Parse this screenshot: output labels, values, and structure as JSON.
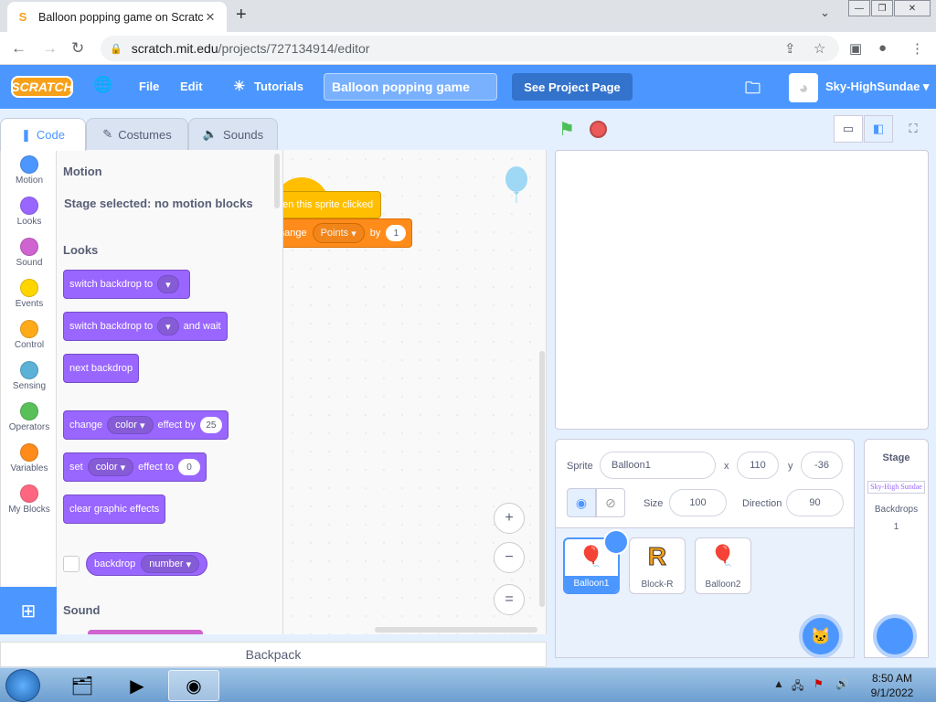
{
  "browser": {
    "tab_title": "Balloon popping game on Scratch",
    "tab_favicon": "S",
    "close_tab": "✕",
    "new_tab": "+",
    "tab_dropdown": "⌄",
    "url_domain": "scratch.mit.edu",
    "url_path": "/projects/727134914/editor",
    "back": "←",
    "forward": "→",
    "reload": "↻",
    "lock": "🔒"
  },
  "menubar": {
    "logo": "SCRATCH",
    "globe": "🌐",
    "file": "File",
    "edit": "Edit",
    "tutorials": "Tutorials",
    "project_title": "Balloon popping game",
    "see_project": "See Project Page",
    "username": "Sky-HighSundae"
  },
  "tabs": {
    "code": "Code",
    "costumes": "Costumes",
    "sounds": "Sounds"
  },
  "categories": [
    {
      "label": "Motion",
      "color": "#4c97ff"
    },
    {
      "label": "Looks",
      "color": "#9966ff"
    },
    {
      "label": "Sound",
      "color": "#cf63cf"
    },
    {
      "label": "Events",
      "color": "#ffd500"
    },
    {
      "label": "Control",
      "color": "#ffab19"
    },
    {
      "label": "Sensing",
      "color": "#5cb1d6"
    },
    {
      "label": "Operators",
      "color": "#59c059"
    },
    {
      "label": "Variables",
      "color": "#ff8c1a"
    },
    {
      "label": "My Blocks",
      "color": "#ff6680"
    }
  ],
  "palette": {
    "motion_header": "Motion",
    "motion_note": "Stage selected: no motion blocks",
    "looks_header": "Looks",
    "switch_backdrop": "switch backdrop to",
    "switch_backdrop_wait_a": "switch backdrop to",
    "and_wait": "and wait",
    "next_backdrop": "next backdrop",
    "change": "change",
    "color_dd": "color",
    "effect_by": "effect by",
    "effect_by_val": "25",
    "set": "set",
    "effect_to": "effect to",
    "effect_to_val": "0",
    "clear_effects": "clear graphic effects",
    "backdrop": "backdrop",
    "number_dd": "number",
    "sound_header": "Sound"
  },
  "script": {
    "hat": "hen this sprite clicked",
    "change": "hange",
    "var_dd": "Points",
    "by": "by",
    "by_val": "1"
  },
  "zoom": {
    "in": "+",
    "out": "−",
    "reset": "="
  },
  "backpack": "Backpack",
  "sprite_info": {
    "sprite_label": "Sprite",
    "sprite_name": "Balloon1",
    "x_label": "x",
    "x_val": "110",
    "y_label": "y",
    "y_val": "-36",
    "size_label": "Size",
    "size_val": "100",
    "direction_label": "Direction",
    "direction_val": "90"
  },
  "sprites": [
    {
      "name": "Balloon1",
      "icon": "🎈"
    },
    {
      "name": "Block-R",
      "icon": "R"
    },
    {
      "name": "Balloon2",
      "icon": "🎈"
    }
  ],
  "stage_panel": {
    "title": "Stage",
    "thumb_text": "Sky-High Sundae",
    "backdrops_label": "Backdrops",
    "backdrops_count": "1"
  },
  "taskbar": {
    "time": "8:50 AM",
    "date": "9/1/2022"
  }
}
